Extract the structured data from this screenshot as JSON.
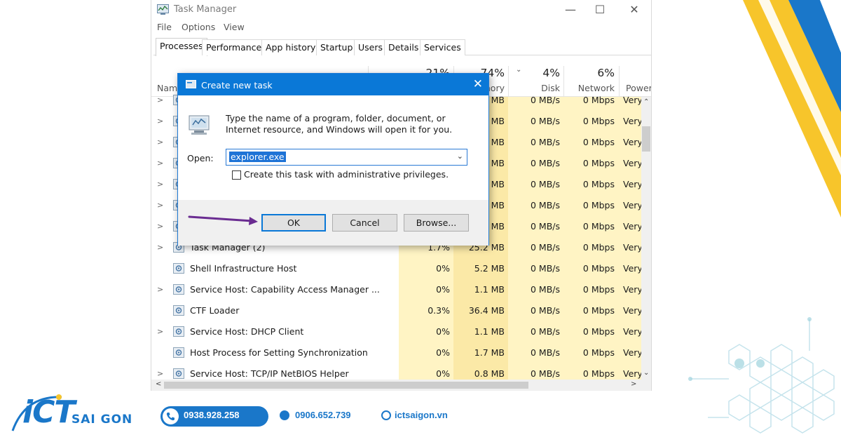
{
  "window": {
    "title": "Task Manager",
    "minimize_glyph": "—",
    "maximize_glyph": "☐",
    "close_glyph": "✕"
  },
  "menu": [
    "File",
    "Options",
    "View"
  ],
  "tabs": [
    "Processes",
    "Performance",
    "App history",
    "Startup",
    "Users",
    "Details",
    "Services"
  ],
  "columns": {
    "name": "Name",
    "cpu_pct": "21%",
    "memory_pct": "74%",
    "memory_label": "Memory",
    "disk_pct": "4%",
    "disk_label": "Disk",
    "network_pct": "6%",
    "network_label": "Network",
    "power_label": "Power"
  },
  "processes": [
    {
      "name": "",
      "cpu": "",
      "memory": "MB",
      "disk": "0 MB/s",
      "network": "0 Mbps",
      "power": "Very",
      "expand": true
    },
    {
      "name": "",
      "cpu": "",
      "memory": "MB",
      "disk": "0 MB/s",
      "network": "0 Mbps",
      "power": "Very",
      "expand": true
    },
    {
      "name": "",
      "cpu": "",
      "memory": "MB",
      "disk": "0 MB/s",
      "network": "0 Mbps",
      "power": "Very",
      "expand": true
    },
    {
      "name": "",
      "cpu": "",
      "memory": "MB",
      "disk": "0 MB/s",
      "network": "0 Mbps",
      "power": "Very",
      "expand": true
    },
    {
      "name": "",
      "cpu": "",
      "memory": "MB",
      "disk": "0 MB/s",
      "network": "0 Mbps",
      "power": "Very",
      "expand": true
    },
    {
      "name": "",
      "cpu": "",
      "memory": "MB",
      "disk": "0 MB/s",
      "network": "0 Mbps",
      "power": "Very",
      "expand": true
    },
    {
      "name": "",
      "cpu": "",
      "memory": "MB",
      "disk": "0 MB/s",
      "network": "0 Mbps",
      "power": "Very",
      "expand": true
    },
    {
      "name": "Task Manager (2)",
      "cpu": "1.7%",
      "memory": "25.2 MB",
      "disk": "0 MB/s",
      "network": "0 Mbps",
      "power": "Very",
      "expand": true
    },
    {
      "name": "Shell Infrastructure Host",
      "cpu": "0%",
      "memory": "5.2 MB",
      "disk": "0 MB/s",
      "network": "0 Mbps",
      "power": "Very",
      "expand": false
    },
    {
      "name": "Service Host: Capability Access Manager ...",
      "cpu": "0%",
      "memory": "1.1 MB",
      "disk": "0 MB/s",
      "network": "0 Mbps",
      "power": "Very",
      "expand": true
    },
    {
      "name": "CTF Loader",
      "cpu": "0.3%",
      "memory": "36.4 MB",
      "disk": "0 MB/s",
      "network": "0 Mbps",
      "power": "Very",
      "expand": false
    },
    {
      "name": "Service Host: DHCP Client",
      "cpu": "0%",
      "memory": "1.1 MB",
      "disk": "0 MB/s",
      "network": "0 Mbps",
      "power": "Very",
      "expand": true
    },
    {
      "name": "Host Process for Setting Synchronization",
      "cpu": "0%",
      "memory": "1.7 MB",
      "disk": "0 MB/s",
      "network": "0 Mbps",
      "power": "Very",
      "expand": false
    },
    {
      "name": "Service Host: TCP/IP NetBIOS Helper",
      "cpu": "0%",
      "memory": "0.8 MB",
      "disk": "0 MB/s",
      "network": "0 Mbps",
      "power": "Very",
      "expand": true
    }
  ],
  "dialog": {
    "title": "Create new task",
    "description": "Type the name of a program, folder, document, or Internet resource, and Windows will open it for you.",
    "open_label": "Open:",
    "open_value": "explorer.exe",
    "admin_checkbox_label": "Create this task with administrative privileges.",
    "admin_checked": false,
    "ok_label": "OK",
    "cancel_label": "Cancel",
    "browse_label": "Browse..."
  },
  "branding": {
    "logo_ict": "iCT",
    "logo_saigon": "SAI GON",
    "phone_primary": "0938.928.258",
    "phone_secondary": "0906.652.739",
    "website": "ictsaigon.vn"
  },
  "colors": {
    "accent": "#0a78d7",
    "brand_blue": "#1a77c9",
    "heat_light": "#fff4c4",
    "heat_medium": "#fbe9a7",
    "arrow": "#6a2c91",
    "stripe_yellow": "#f7c52b",
    "stripe_blue": "#1a77c9"
  }
}
